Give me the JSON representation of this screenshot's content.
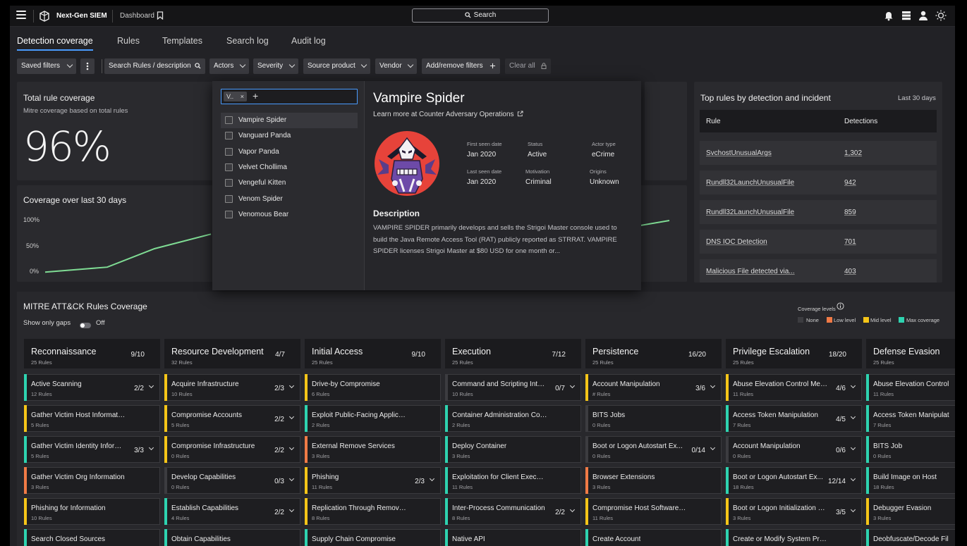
{
  "header": {
    "app_name": "Next-Gen SIEM",
    "breadcrumb": "Dashboard",
    "search_label": "Search"
  },
  "tabs": [
    "Detection coverage",
    "Rules",
    "Templates",
    "Search log",
    "Audit log"
  ],
  "filters": {
    "saved": "Saved filters",
    "search": "Search Rules / description",
    "actors": "Actors",
    "severity": "Severity",
    "source": "Source product",
    "vendor": "Vendor",
    "add": "Add/remove filters",
    "clear": "Clear all"
  },
  "total": {
    "title": "Total rule coverage",
    "subtitle": "Mitre coverage based on total rules",
    "value": "96%"
  },
  "coverage": {
    "title": "Coverage over last 30 days",
    "y_labels": [
      "100%",
      "50%",
      "0%"
    ]
  },
  "chart_data": {
    "type": "line",
    "title": "Coverage over last 30 days",
    "ylim": [
      0,
      100
    ],
    "y_ticks": [
      "100%",
      "50%",
      "0%"
    ],
    "series": [
      {
        "values": [
          5,
          14,
          48,
          75
        ],
        "color": "#7fdc94"
      },
      {
        "values": [
          90,
          100
        ],
        "color": "#7fdc94"
      }
    ],
    "grid": false
  },
  "top_rules": {
    "title": "Top rules by detection and incident",
    "range": "Last 30 days",
    "col_rule": "Rule",
    "col_det": "Detections",
    "rows": [
      {
        "rule": "SvchostUnusualArgs",
        "det": "1,302"
      },
      {
        "rule": "Rundll32LaunchUnusualFile",
        "det": "942"
      },
      {
        "rule": "Rundll32LaunchUnusualFile",
        "det": "859"
      },
      {
        "rule": "DNS IOC Detection",
        "det": "701"
      },
      {
        "rule": "Malicious File detected via...",
        "det": "403"
      }
    ]
  },
  "popup": {
    "chip": "V..",
    "options": [
      "Vampire Spider",
      "Vanguard Panda",
      "Vapor Panda",
      "Velvet Chollima",
      "Vengeful Kitten",
      "Venom Spider",
      "Venomous Bear"
    ],
    "name": "Vampire Spider",
    "link": "Learn more at Counter Adversary Operations",
    "meta": {
      "first_seen_label": "First seen date",
      "first_seen": "Jan 2020",
      "status_label": "Status",
      "status": "Active",
      "actor_type_label": "Actor type",
      "actor_type": "eCrime",
      "last_seen_label": "Last seen date",
      "last_seen": "Jan 2020",
      "motivation_label": "Motivation",
      "motivation": "Criminal",
      "origins_label": "Origins",
      "origins": "Unknown"
    },
    "desc_title": "Description",
    "desc": "VAMPIRE SPIDER primarily develops and sells the Strigoi Master console used to build the Java Remote Access Tool (RAT) publicly reported as STRRAT. VAMPIRE SPIDER licenses Strigoi Master at $80 USD for one month or..."
  },
  "mitre": {
    "title": "MITRE ATT&CK Rules Coverage",
    "gaps_label": "Show only gaps",
    "gaps_state": "Off",
    "legend_title": "Coverage levels",
    "legend": [
      {
        "label": "None",
        "color": "#3c3c40"
      },
      {
        "label": "Low level",
        "color": "#f07a46"
      },
      {
        "label": "Mid level",
        "color": "#f5c518"
      },
      {
        "label": "Max coverage",
        "color": "#2ed3b0"
      }
    ],
    "colors": {
      "none": "#3c3c40",
      "low": "#f07a46",
      "mid": "#f5c518",
      "max": "#2ed3b0"
    },
    "columns": [
      {
        "title": "Reconnaissance",
        "count": "9/10",
        "sub": "25 Rules",
        "cells": [
          {
            "name": "Active Scanning",
            "rules": "12 Rules",
            "count": "2/2",
            "level": "max"
          },
          {
            "name": "Gather Victim Host Information",
            "rules": "5 Rules",
            "count": "",
            "level": "mid"
          },
          {
            "name": "Gather Victim Identity Informa...",
            "rules": "5 Rules",
            "count": "3/3",
            "level": "max"
          },
          {
            "name": "Gather Victim Org Information",
            "rules": "3 Rules",
            "count": "",
            "level": "low"
          },
          {
            "name": "Phishing for Information",
            "rules": "10 Rules",
            "count": "",
            "level": "mid"
          },
          {
            "name": "Search Closed Sources",
            "rules": "",
            "count": "",
            "level": "max"
          }
        ]
      },
      {
        "title": "Resource Development",
        "count": "4/7",
        "sub": "32 Rules",
        "cells": [
          {
            "name": "Acquire Infrastructure",
            "rules": "10 Rules",
            "count": "2/3",
            "level": "mid"
          },
          {
            "name": "Compromise Accounts",
            "rules": "5 Rules",
            "count": "2/2",
            "level": "mid"
          },
          {
            "name": "Compromise Infrastructure",
            "rules": "0 Rules",
            "count": "2/2",
            "level": "mid"
          },
          {
            "name": "Develop Capabilities",
            "rules": "0 Rules",
            "count": "0/3",
            "level": "none"
          },
          {
            "name": "Establish Capabilities",
            "rules": "4 Rules",
            "count": "2/2",
            "level": "max"
          },
          {
            "name": "Obtain Capabilities",
            "rules": "",
            "count": "",
            "level": "max"
          }
        ]
      },
      {
        "title": "Initial Access",
        "count": "9/10",
        "sub": "25 Rules",
        "cells": [
          {
            "name": "Drive-by Compromise",
            "rules": "6 Rules",
            "count": "",
            "level": "mid"
          },
          {
            "name": "Exploit Public-Facing Application",
            "rules": "2 Rules",
            "count": "",
            "level": "max"
          },
          {
            "name": "External Remove Services",
            "rules": "3 Rules",
            "count": "",
            "level": "low"
          },
          {
            "name": "Phishing",
            "rules": "11 Rules",
            "count": "2/3",
            "level": "mid"
          },
          {
            "name": "Replication Through Removeab...",
            "rules": "8 Rules",
            "count": "",
            "level": "mid"
          },
          {
            "name": "Supply Chain Compromise",
            "rules": "",
            "count": "",
            "level": "max"
          }
        ]
      },
      {
        "title": "Execution",
        "count": "7/12",
        "sub": "25 Rules",
        "cells": [
          {
            "name": "Command and Scripting Inter...",
            "rules": "10 Rules",
            "count": "0/7",
            "level": "none"
          },
          {
            "name": "Container Administration Comm...",
            "rules": "2 Rules",
            "count": "",
            "level": "max"
          },
          {
            "name": "Deploy Container",
            "rules": "3 Rules",
            "count": "",
            "level": "max"
          },
          {
            "name": "Exploitation for Client Execution",
            "rules": "11 Rules",
            "count": "",
            "level": "max"
          },
          {
            "name": "Inter-Process Communication",
            "rules": "8 Rules",
            "count": "2/2",
            "level": "max"
          },
          {
            "name": "Native API",
            "rules": "",
            "count": "",
            "level": "max"
          }
        ]
      },
      {
        "title": "Persistence",
        "count": "16/20",
        "sub": "25 Rules",
        "cells": [
          {
            "name": "Account Manipulation",
            "rules": "# Rules",
            "count": "3/6",
            "level": "mid"
          },
          {
            "name": "BITS Jobs",
            "rules": "0 Rules",
            "count": "",
            "level": "none"
          },
          {
            "name": "Boot or Logon Autostart Ex...",
            "rules": "0 Rules",
            "count": "0/14",
            "level": "none"
          },
          {
            "name": "Browser Extensions",
            "rules": "3 Rules",
            "count": "",
            "level": "low"
          },
          {
            "name": "Compromise Host Software Bin...",
            "rules": "11 Rules",
            "count": "",
            "level": "mid"
          },
          {
            "name": "Create Account",
            "rules": "",
            "count": "",
            "level": "max"
          }
        ]
      },
      {
        "title": "Privilege Escalation",
        "count": "18/20",
        "sub": "25 Rules",
        "cells": [
          {
            "name": "Abuse Elevation Control Mech...",
            "rules": "11 Rules",
            "count": "4/6",
            "level": "mid"
          },
          {
            "name": "Access Token Manipulation",
            "rules": "7 Rules",
            "count": "4/5",
            "level": "max"
          },
          {
            "name": "Account Manipulation",
            "rules": "0 Rules",
            "count": "0/6",
            "level": "none"
          },
          {
            "name": "Boot or Logon Autostart Ex...",
            "rules": "18 Rules",
            "count": "12/14",
            "level": "max"
          },
          {
            "name": "Boot or Logon Initialization Scr...",
            "rules": "3 Rules",
            "count": "3/5",
            "level": "mid"
          },
          {
            "name": "Create or Modify System Proc...",
            "rules": "",
            "count": "",
            "level": "max"
          }
        ]
      },
      {
        "title": "Defense Evasion",
        "count": "",
        "sub": "25 Rules",
        "cells": [
          {
            "name": "Abuse Elevation Control",
            "rules": "11 Rules",
            "count": "",
            "level": "max"
          },
          {
            "name": "Access Token Manipulat",
            "rules": "7 Rules",
            "count": "",
            "level": "max"
          },
          {
            "name": "BITS Job",
            "rules": "0 Rules",
            "count": "",
            "level": "max"
          },
          {
            "name": "Build Image on Host",
            "rules": "18 Rules",
            "count": "",
            "level": "max"
          },
          {
            "name": "Debugger Evasion",
            "rules": "3 Rules",
            "count": "",
            "level": "mid"
          },
          {
            "name": "Deobfuscate/Decode Fil",
            "rules": "",
            "count": "",
            "level": "max"
          }
        ]
      }
    ]
  }
}
